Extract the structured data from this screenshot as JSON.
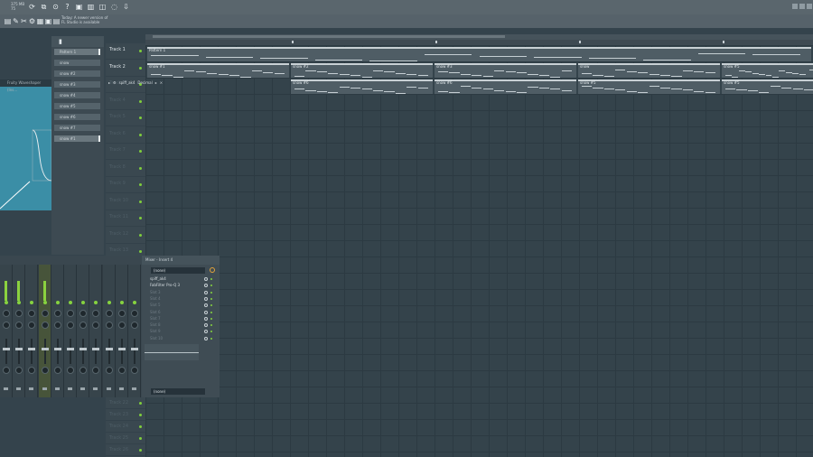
{
  "app": {
    "memory": "375 MB",
    "memory_sub": "75",
    "news_title": "Today",
    "news_line1": "A newer version of",
    "news_line2": "FL Studio is available"
  },
  "toolbar": {
    "icons": [
      "refresh-icon",
      "mixer-icon",
      "mic-icon",
      "help-icon",
      "save-icon",
      "render-icon",
      "cpu-icon",
      "chat-icon",
      "download-icon"
    ],
    "row2_icons": [
      "new-file-icon",
      "tool-icon",
      "cut-icon",
      "plugin-icon",
      "piano-icon",
      "browser-icon",
      "playlist-icon"
    ]
  },
  "plugin_window": {
    "title": "Fruity Waveshaper (Ins..."
  },
  "patterns": {
    "items": [
      {
        "label": "Pattern 1",
        "active": true
      },
      {
        "label": "snow",
        "active": false
      },
      {
        "label": "snow #2",
        "active": false
      },
      {
        "label": "snow #3",
        "active": false
      },
      {
        "label": "snow #4",
        "active": false
      },
      {
        "label": "snow #5",
        "active": false
      },
      {
        "label": "snow #6",
        "active": false
      },
      {
        "label": "snow #7",
        "active": false
      },
      {
        "label": "snow #1",
        "active": true
      }
    ]
  },
  "tracks": [
    {
      "label": "Track 1",
      "on": true
    },
    {
      "label": "Track 2",
      "on": true
    },
    {
      "label": "Track 3",
      "on": false
    },
    {
      "label": "Track 4",
      "on": false
    },
    {
      "label": "Track 5",
      "on": false
    },
    {
      "label": "Track 6",
      "on": false
    },
    {
      "label": "Track 7",
      "on": false
    },
    {
      "label": "Track 8",
      "on": false
    },
    {
      "label": "Track 9",
      "on": false
    },
    {
      "label": "Track 10",
      "on": false
    },
    {
      "label": "Track 11",
      "on": false
    },
    {
      "label": "Track 12",
      "on": false
    },
    {
      "label": "Track 13",
      "on": false
    }
  ],
  "bottom_tracks": [
    "Track 22",
    "Track 23",
    "Track 24",
    "Track 25",
    "Track 26"
  ],
  "clips": {
    "pattern_label": "Pattern 1",
    "snow_labels": [
      "snow #1",
      "snow #2",
      "snow #3",
      "snow",
      "snow #4",
      "snow #5"
    ],
    "row3_labels": [
      "snow #6",
      "snow #6",
      "snow #5",
      "snow #5"
    ]
  },
  "automation": {
    "label": "spiff_ak4",
    "target": "Decimal"
  },
  "mixer": {
    "title": "Mixer - Insert 4",
    "input": "(none)",
    "output": "(none)",
    "slots": [
      {
        "label": "spiff_ak4",
        "on": true
      },
      {
        "label": "FabFilter Pro-Q 3",
        "on": true
      },
      {
        "label": "Slot 3",
        "on": false
      },
      {
        "label": "Slot 4",
        "on": false
      },
      {
        "label": "Slot 5",
        "on": false
      },
      {
        "label": "Slot 6",
        "on": false
      },
      {
        "label": "Slot 7",
        "on": false
      },
      {
        "label": "Slot 8",
        "on": false
      },
      {
        "label": "Slot 9",
        "on": false
      },
      {
        "label": "Slot 10",
        "on": false
      }
    ],
    "strip_count": 11,
    "selected_strip": 4
  },
  "colors": {
    "accent_green": "#86d33f",
    "accent_orange": "#e5a43a",
    "background": "#34434b"
  }
}
